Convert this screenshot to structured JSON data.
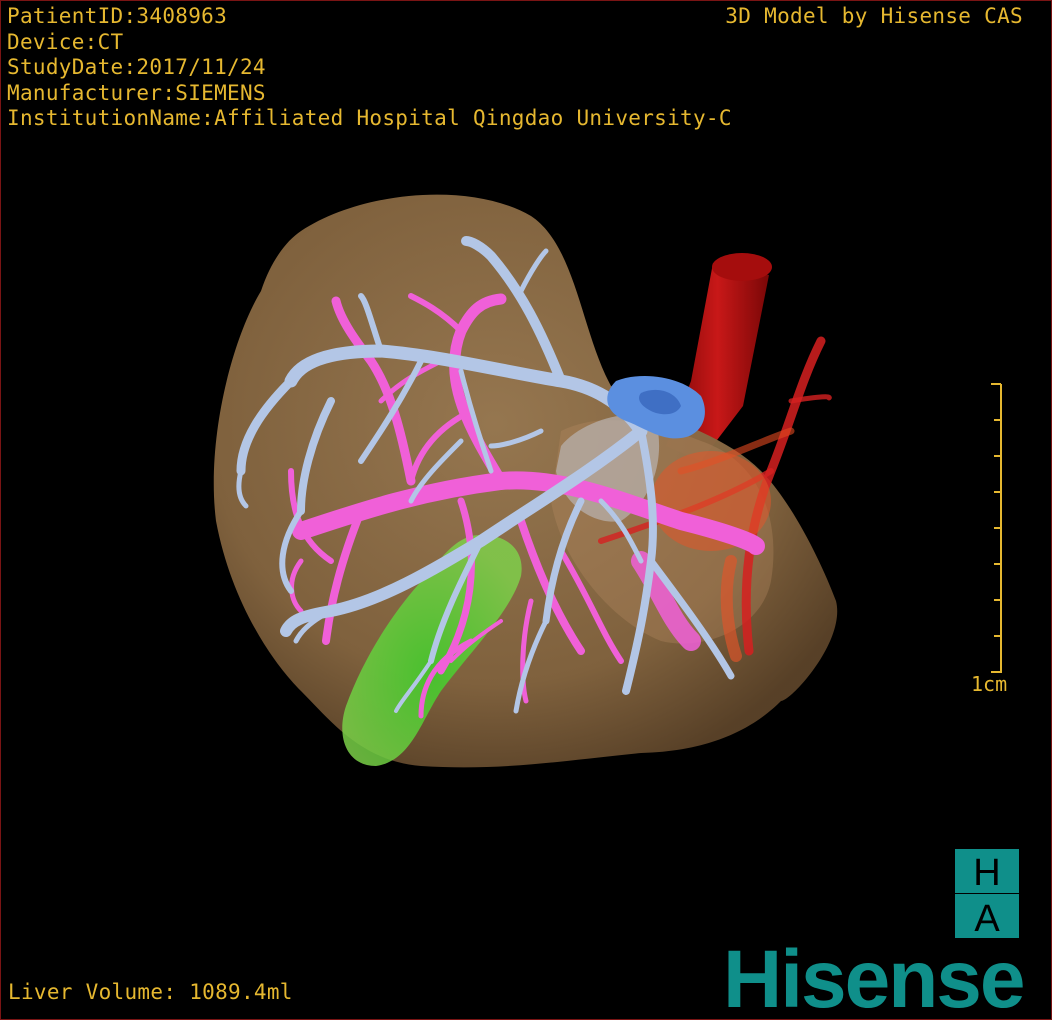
{
  "patient": {
    "id_line": "PatientID:3408963",
    "device_line": "Device:CT",
    "study_date_line": "StudyDate:2017/11/24",
    "manufacturer_line": "Manufacturer:SIEMENS",
    "institution_line": "InstitutionName:Affiliated Hospital Qingdao University-C"
  },
  "credit": "3D Model by Hisense CAS",
  "scale": {
    "label": "1cm"
  },
  "volume_line": "Liver Volume: 1089.4ml",
  "logo": {
    "letter_top": "H",
    "letter_bottom": "A",
    "brand_name": "Hisense"
  },
  "colors": {
    "overlay_text": "#e6b830",
    "liver": "#8a6a45",
    "portal_vein": "#b3c6e6",
    "hepatic_vein": "#f060d8",
    "aorta": "#b80f0f",
    "gallbladder": "#6ccf3a",
    "tumor": "#5b8fe0",
    "brand": "#0f8f8a"
  }
}
